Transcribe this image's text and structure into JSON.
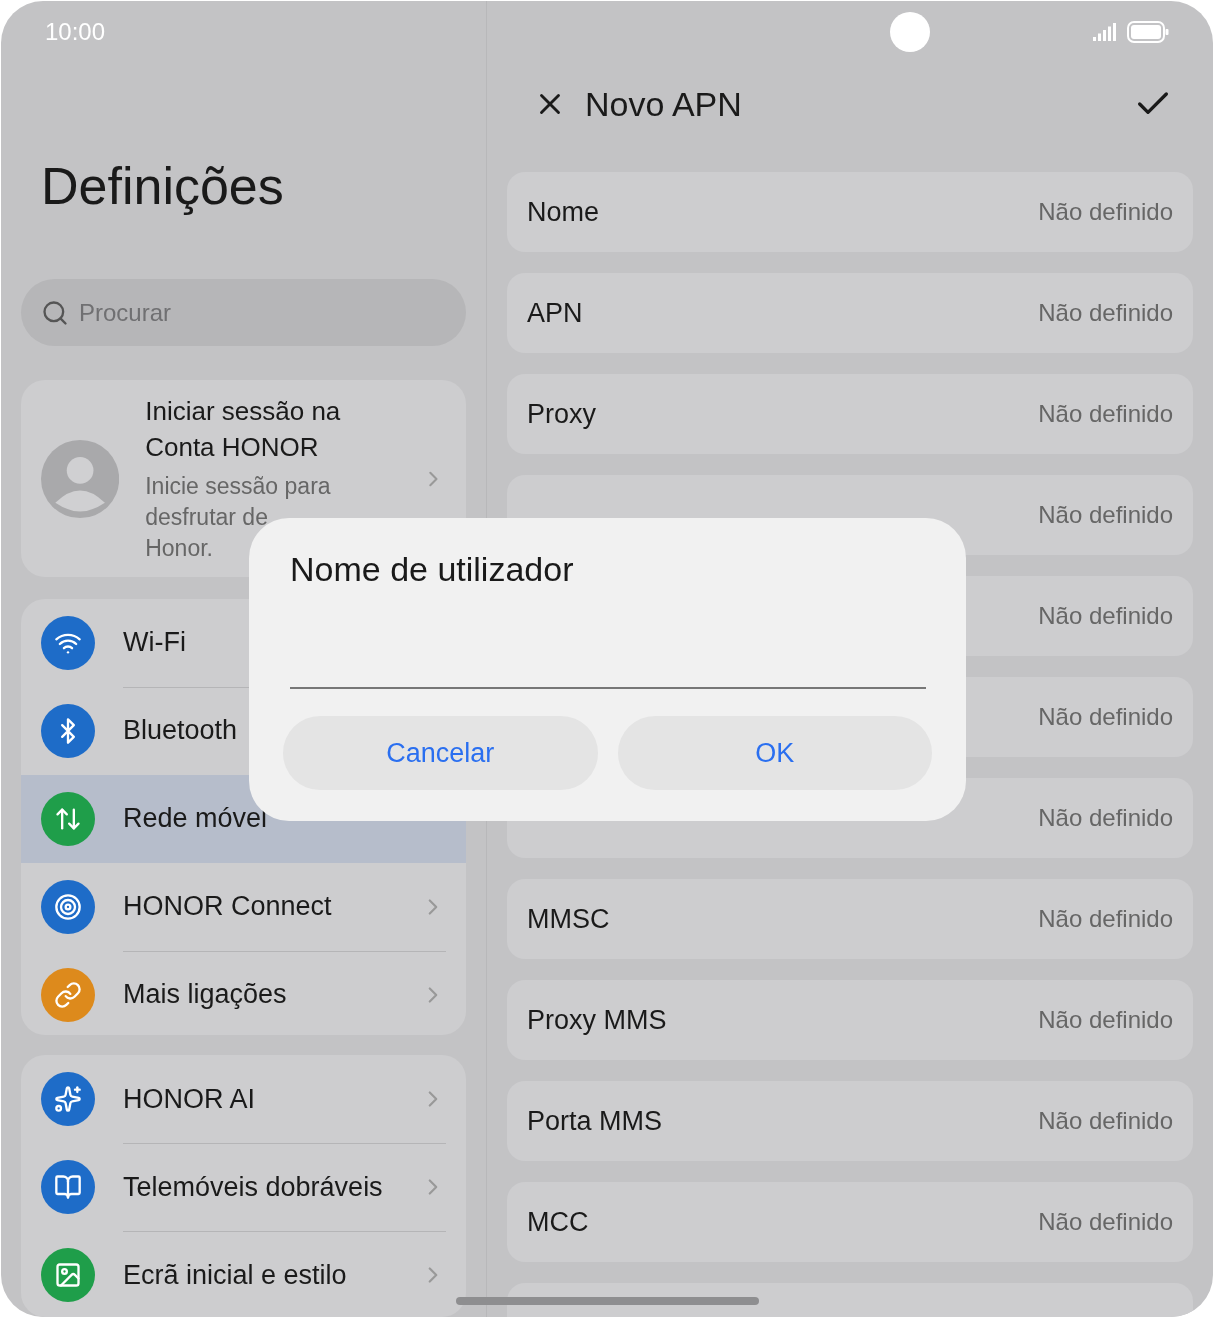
{
  "status_bar": {
    "time": "10:00"
  },
  "settings": {
    "title": "Definições",
    "search": {
      "placeholder": "Procurar"
    },
    "account": {
      "title": "Iniciar sessão na Conta HONOR",
      "subtitle": "Inicie sessão para desfrutar de",
      "subtitle_end": "Honor."
    },
    "groups": [
      {
        "items": [
          {
            "label": "Wi-Fi",
            "color": "#1e6cc8",
            "selected": false,
            "chevron": false
          },
          {
            "label": "Bluetooth",
            "color": "#1e6cc8",
            "selected": false,
            "chevron": false
          },
          {
            "label": "Rede móvel",
            "color": "#1f9e4a",
            "selected": true,
            "chevron": false
          },
          {
            "label": "HONOR Connect",
            "color": "#1e6cc8",
            "selected": false,
            "chevron": true
          },
          {
            "label": "Mais ligações",
            "color": "#dd8a1c",
            "selected": false,
            "chevron": true
          }
        ]
      },
      {
        "items": [
          {
            "label": "HONOR AI",
            "color": "#1e6cc8",
            "selected": false,
            "chevron": true
          },
          {
            "label": "Telemóveis dobráveis",
            "color": "#1e6cc8",
            "selected": false,
            "chevron": true
          },
          {
            "label": "Ecrã inicial e estilo",
            "color": "#1f9e4a",
            "selected": false,
            "chevron": true
          }
        ]
      }
    ]
  },
  "apn": {
    "title": "Novo APN",
    "fields": [
      {
        "label": "Nome",
        "value": "Não definido"
      },
      {
        "label": "APN",
        "value": "Não definido"
      },
      {
        "label": "Proxy",
        "value": "Não definido"
      },
      {
        "value": "Não definido"
      },
      {
        "value": "Não definido"
      },
      {
        "value": "Não definido"
      },
      {
        "value": "Não definido"
      },
      {
        "label": "MMSC",
        "value": "Não definido"
      },
      {
        "label": "Proxy MMS",
        "value": "Não definido"
      },
      {
        "label": "Porta MMS",
        "value": "Não definido"
      },
      {
        "label": "MCC",
        "value": "Não definido"
      }
    ]
  },
  "dialog": {
    "title": "Nome de utilizador",
    "buttons": [
      "Cancelar",
      "OK"
    ]
  }
}
